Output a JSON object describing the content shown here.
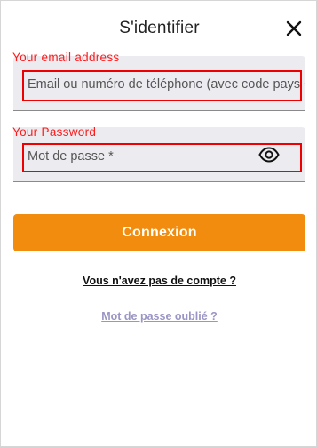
{
  "header": {
    "title": "S'identifier",
    "close_icon": "close-icon"
  },
  "email": {
    "annotation_label": "Your email address",
    "placeholder": "Email ou numéro de téléphone (avec code pays +)"
  },
  "password": {
    "annotation_label": "Your Password",
    "placeholder": "Mot de passe *",
    "toggle_icon": "eye-icon"
  },
  "actions": {
    "login_label": "Connexion",
    "signup_link": "Vous n'avez pas de compte ?",
    "forgot_link": "Mot de passe oublié ?"
  },
  "colors": {
    "accent": "#f28c0f",
    "field_bg": "#ecebf0",
    "annotation": "#ee0000",
    "forgot_link": "#9a95c4"
  }
}
